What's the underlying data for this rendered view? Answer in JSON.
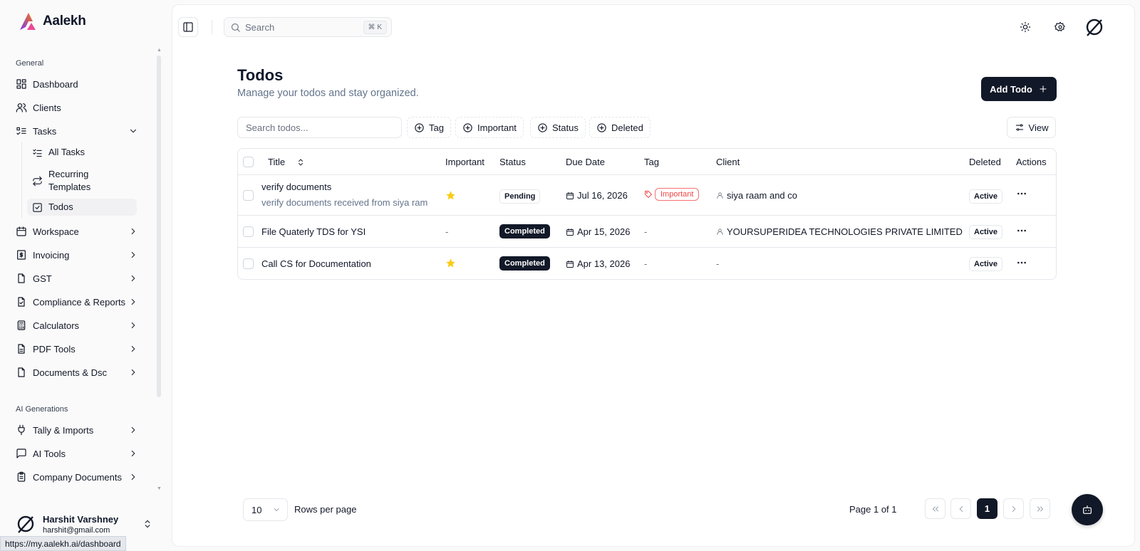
{
  "brand": {
    "name": "Aalekh",
    "accent": "#7c3aed"
  },
  "sidebar": {
    "section_general": "General",
    "section_ai": "AI Generations",
    "items": [
      {
        "label": "Dashboard",
        "icon": "layout-dashboard-icon"
      },
      {
        "label": "Clients",
        "icon": "users-icon"
      },
      {
        "label": "Tasks",
        "icon": "list-todo-icon",
        "expanded": true
      },
      {
        "label": "Workspace",
        "icon": "calendar-icon"
      },
      {
        "label": "Invoicing",
        "icon": "receipt-icon"
      },
      {
        "label": "GST",
        "icon": "file-icon"
      },
      {
        "label": "Compliance & Reports",
        "icon": "file-check-icon"
      },
      {
        "label": "Calculators",
        "icon": "calculator-icon"
      },
      {
        "label": "PDF Tools",
        "icon": "file-text-icon"
      },
      {
        "label": "Documents & Dsc",
        "icon": "file-icon"
      }
    ],
    "task_subitems": [
      {
        "label": "All Tasks"
      },
      {
        "label": "Recurring Templates"
      },
      {
        "label": "Todos",
        "active": true
      }
    ],
    "ai_items": [
      {
        "label": "Tally & Imports",
        "icon": "plug-icon"
      },
      {
        "label": "AI Tools",
        "icon": "message-square-icon"
      },
      {
        "label": "Company Documents",
        "icon": "clipboard-icon"
      }
    ],
    "user": {
      "name": "Harshit Varshney",
      "email": "harshit@gmail.com"
    },
    "status_url": "https://my.aalekh.ai/dashboard"
  },
  "topbar": {
    "search_placeholder": "Search",
    "shortcut": "⌘ K"
  },
  "page": {
    "title": "Todos",
    "subtitle": "Manage your todos and stay organized.",
    "add_label": "Add Todo",
    "search_placeholder": "Search todos...",
    "filters": [
      "Tag",
      "Important",
      "Status",
      "Deleted"
    ],
    "view_label": "View"
  },
  "table": {
    "headers": [
      "Title",
      "Important",
      "Status",
      "Due Date",
      "Tag",
      "Client",
      "Deleted",
      "Actions"
    ],
    "rows": [
      {
        "title": "verify documents",
        "desc": "verify documents received from siya ram",
        "important": true,
        "status": "Pending",
        "due": "Jul 16, 2026",
        "tag": "Important",
        "client": "siya raam and co",
        "deleted": "Active"
      },
      {
        "title": "File Quaterly TDS for YSI",
        "important_text": "-",
        "important": false,
        "status": "Completed",
        "due": "Apr 15, 2026",
        "tag_text": "-",
        "client": "YOURSUPERIDEA TECHNOLOGIES PRIVATE LIMITED",
        "deleted": "Active"
      },
      {
        "title": "Call CS for Documentation",
        "important": true,
        "status": "Completed",
        "due": "Apr 13, 2026",
        "tag_text": "-",
        "client_text": "-",
        "deleted": "Active"
      }
    ]
  },
  "pagination": {
    "rows_per_page": "10",
    "rows_label": "Rows per page",
    "page_info": "Page 1 of 1",
    "current": "1"
  }
}
